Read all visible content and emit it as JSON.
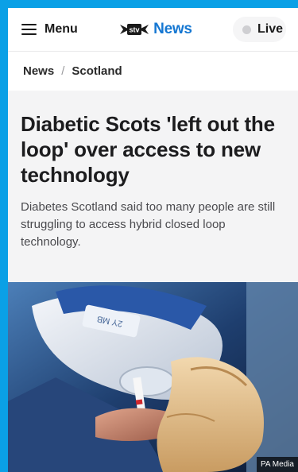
{
  "header": {
    "menu_label": "Menu",
    "logo_text": "News",
    "live_label": "Live"
  },
  "breadcrumb": {
    "items": [
      "News",
      "Scotland"
    ],
    "separator": "/"
  },
  "article": {
    "headline": "Diabetic Scots 'left out the loop' over access to new technology",
    "standfirst": "Diabetes Scotland said too many people are still struggling to access hybrid closed loop technology."
  },
  "image": {
    "credit": "PA Media",
    "device_label": "2Y MB"
  },
  "colors": {
    "frame": "#0aa0e6",
    "brand_blue": "#1577d2",
    "text": "#1c1c1e"
  }
}
